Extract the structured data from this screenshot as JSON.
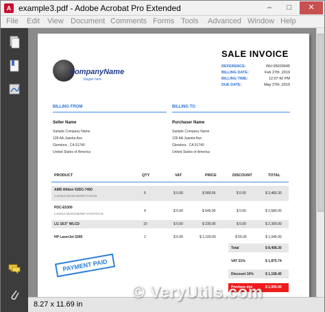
{
  "window": {
    "title": "example3.pdf - Adobe Acrobat Pro Extended",
    "app_icon_glyph": "A",
    "min_glyph": "–",
    "max_glyph": "□",
    "close_glyph": "✕"
  },
  "menu": [
    "File",
    "Edit",
    "View",
    "Document",
    "Comments",
    "Forms",
    "Tools",
    "Advanced",
    "Window",
    "Help"
  ],
  "sidebar_icons": [
    "pages-icon",
    "bookmarks-icon",
    "signatures-icon",
    "comments-icon",
    "attachments-icon"
  ],
  "status": {
    "page_size": "8.27 x 11.69 in"
  },
  "watermark": "© VeryUtils.com",
  "invoice": {
    "title": "SALE INVOICE",
    "company_name": "CompanyName",
    "slogan": "Slogan here",
    "meta": [
      {
        "label": "REFERENCE:",
        "value": "INV-05033645"
      },
      {
        "label": "BILLING DATE:",
        "value": "Feb 27th ,2019"
      },
      {
        "label": "BILLING TIME:",
        "value": "12:07:42 PM"
      },
      {
        "label": "DUE DATE:",
        "value": "May 27th ,2019"
      }
    ],
    "billing_from": {
      "heading": "BILLING FROM",
      "name": "Seller Name",
      "lines": [
        "Sample Company Name",
        "128 AA Juanita Ave",
        "Glendora , CA 91740",
        "United States of America"
      ]
    },
    "billing_to": {
      "heading": "BILLING TO",
      "name": "Purchaser Name",
      "lines": [
        "Sample Company Name",
        "128 AA Juanita Ave",
        "Glendora , CA 91740",
        "United States of America"
      ]
    },
    "table": {
      "headers": [
        "PRODUCT",
        "QTY",
        "VAT",
        "PRICE",
        "DISCOUNT",
        "TOTAL"
      ],
      "rows": [
        {
          "product": "AMD Athlon X2DC-7450",
          "detail": "2.4GHz/1GB/160GB/SMP-DVD/VB",
          "qty": "6",
          "vat": "$ 0.00",
          "price": "$ 580.55",
          "discount": "$ 0.00",
          "total": "$ 3,483.30"
        },
        {
          "product": "PDC-E5300",
          "detail": "2.6GHz/1GB/320GB/SMP-DVD/FDD/VB",
          "qty": "4",
          "vat": "$ 0.00",
          "price": "$ 645.00",
          "discount": "$ 0.00",
          "total": "$ 2,580.00"
        },
        {
          "product": "LG 18.5\" WLCD",
          "detail": "",
          "qty": "10",
          "vat": "$ 0.00",
          "price": "$ 230.00",
          "discount": "$ 0.00",
          "total": "$ 2,300.00"
        },
        {
          "product": "HP LaserJet 5200",
          "detail": "",
          "qty": "1",
          "vat": "$ 0.00",
          "price": "$ 1,100.00",
          "discount": "$ 55.00",
          "total": "$ 1,045.00"
        }
      ]
    },
    "totals": [
      {
        "label": "Total",
        "value": "$ 8,408.30"
      },
      {
        "label": "VAT 21%",
        "value": "$ 1,875.74"
      },
      {
        "label": "Discount 10%",
        "value": "$ 1,158.40"
      },
      {
        "label": "Previous due",
        "value": "$ 1,000.00"
      }
    ],
    "stamp": "PAYMENT PAID"
  },
  "colors": {
    "accent": "#2a6fd6",
    "due_highlight": "#ee1c1c",
    "close_button": "#c75050"
  }
}
